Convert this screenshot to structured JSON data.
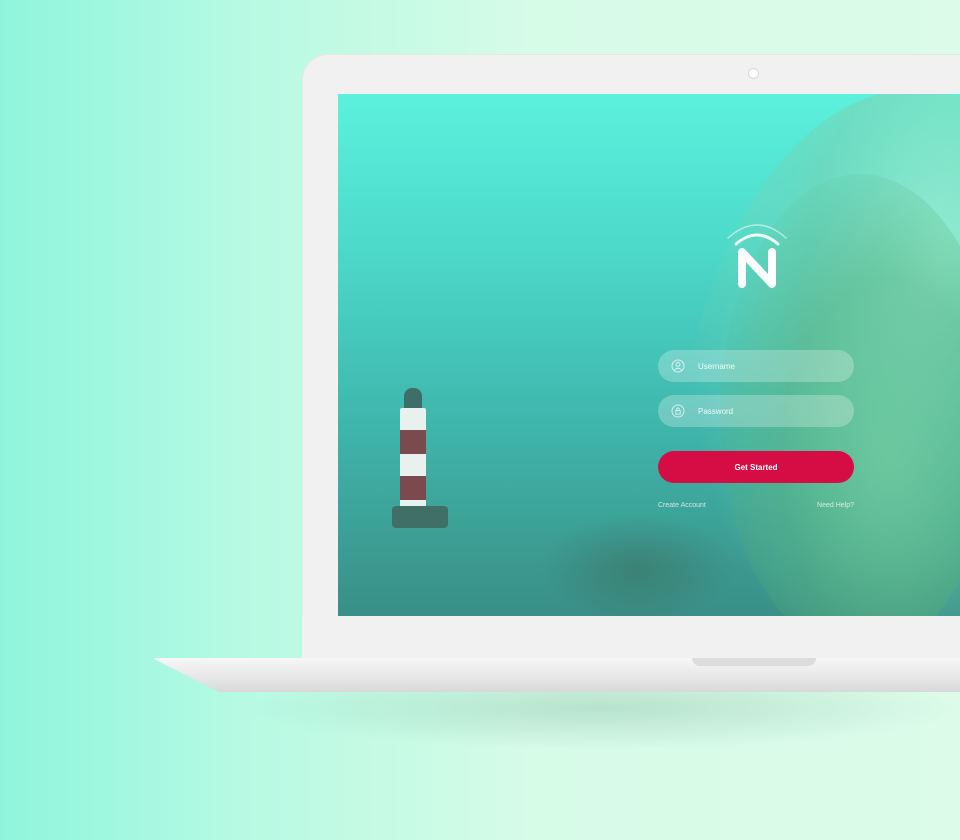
{
  "login": {
    "username_placeholder": "Username",
    "password_placeholder": "Password",
    "submit_label": "Get Started",
    "create_account_label": "Create Account",
    "help_label": "Need Help?"
  },
  "icons": {
    "logo": "n-wifi-logo",
    "username": "user-icon",
    "password": "lock-icon"
  },
  "colors": {
    "accent": "#d60d45",
    "screen_top": "#5cf1dd",
    "screen_bottom": "#3a8f86",
    "background": "#b6fae3"
  }
}
